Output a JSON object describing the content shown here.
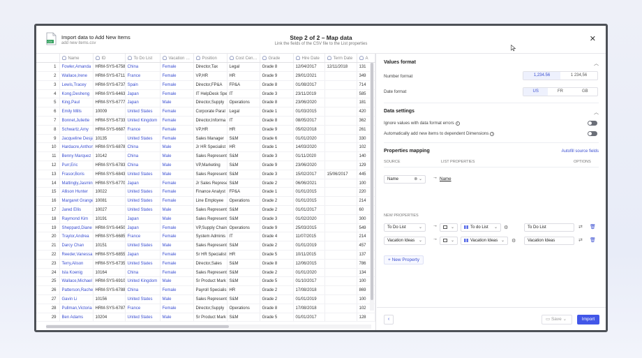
{
  "header": {
    "title": "Import data to Add New Items",
    "filename": "add new items.csv",
    "file_ext": "CSV",
    "step": "Step 2 of 2 – Map data",
    "step_sub": "Link the fields of the CSV file to the List properties"
  },
  "grid": {
    "columns": [
      "",
      "Name",
      "ID",
      "To Do List",
      "Vacation …",
      "Position",
      "Cost Cen…",
      "Grade",
      "Hire Date",
      "Term Date",
      "A"
    ],
    "rows": [
      [
        "1",
        "Fowler,Amanda",
        "HRM-SYS-6758",
        "China",
        "Female",
        "Director,Tax",
        "Legal",
        "Grade 8",
        "12/04/2017",
        "12/11/2018",
        "131"
      ],
      [
        "2",
        "Wallace,Irene",
        "HRM-SYS-6711",
        "France",
        "Female",
        "VP,HR",
        "HR",
        "Grade 9",
        "29/01/2021",
        "",
        "349"
      ],
      [
        "3",
        "Lewis,Tracey",
        "HRM-SYS-6737",
        "Spain",
        "Female",
        "Director,FP&A",
        "FP&A",
        "Grade 8",
        "01/08/2017",
        "",
        "714"
      ],
      [
        "4",
        "Kong,Desheng",
        "HRM-SYS-6463",
        "Japan",
        "Female",
        "IT HelpDesk Spe",
        "IT",
        "Grade 3",
        "23/11/2019",
        "",
        "585"
      ],
      [
        "5",
        "King,Paul",
        "HRM-SYS-6777",
        "Japan",
        "Male",
        "Director,Supply",
        "Operations",
        "Grade 8",
        "23/06/2020",
        "",
        "181"
      ],
      [
        "6",
        "Emily Mills",
        "10009",
        "United States",
        "Female",
        "Corporate Paral",
        "Legal",
        "Grade 1",
        "01/03/2015",
        "",
        "420"
      ],
      [
        "7",
        "Bonnet,Juliette",
        "HRM-SYS-6733",
        "United Kingdom",
        "Female",
        "Director,Informa",
        "IT",
        "Grade 8",
        "08/05/2017",
        "",
        "362"
      ],
      [
        "8",
        "Schwartz,Amy",
        "HRM-SYS-6687",
        "France",
        "Female",
        "VP,HR",
        "HR",
        "Grade 9",
        "05/02/2018",
        "",
        "261"
      ],
      [
        "9",
        "Jacqueline Desjar",
        "10135",
        "United States",
        "Female",
        "Sales Manager",
        "S&M",
        "Grade 6",
        "01/01/2020",
        "",
        "330"
      ],
      [
        "10",
        "Hardacre,Anthon",
        "HRM-SYS-6878",
        "China",
        "Male",
        "Jr HR Specialist",
        "HR",
        "Grade 1",
        "14/03/2020",
        "",
        "102"
      ],
      [
        "11",
        "Benny Marquez",
        "10142",
        "China",
        "Male",
        "Sales Represent",
        "S&M",
        "Grade 3",
        "01/11/2020",
        "",
        "140"
      ],
      [
        "12",
        "Purr,Eric",
        "HRM-SYS-6783",
        "China",
        "Male",
        "VP,Marketing",
        "S&M",
        "Grade 9",
        "23/06/2020",
        "",
        "129"
      ],
      [
        "13",
        "Frasor,Boris",
        "HRM-SYS-6843",
        "United States",
        "Male",
        "Sales Represent",
        "S&M",
        "Grade 3",
        "15/02/2017",
        "15/06/2017",
        "445"
      ],
      [
        "14",
        "Mattingly,Jasmin",
        "HRM-SYS-6770",
        "Japan",
        "Female",
        "Jr Sales Represe",
        "S&M",
        "Grade 2",
        "06/06/2021",
        "",
        "100"
      ],
      [
        "15",
        "Allison Hunter",
        "10022",
        "United States",
        "Female",
        "Finance Analyst",
        "FP&A",
        "Grade 1",
        "01/01/2015",
        "",
        "220"
      ],
      [
        "16",
        "Margaret Grange",
        "10081",
        "United States",
        "Female",
        "Line Employee",
        "Operations",
        "Grade 2",
        "01/01/2015",
        "",
        "214"
      ],
      [
        "17",
        "Jared Ellis",
        "10027",
        "United States",
        "Male",
        "Sales Represent",
        "S&M",
        "Grade 2",
        "01/01/2017",
        "",
        "60"
      ],
      [
        "18",
        "Raymond Kim",
        "10191",
        "Japan",
        "Male",
        "Sales Represent",
        "S&M",
        "Grade 3",
        "01/02/2020",
        "",
        "300"
      ],
      [
        "19",
        "Sheppard,Diane",
        "HRM-SYS-6450",
        "Japan",
        "Female",
        "VP,Supply Chain",
        "Operations",
        "Grade 9",
        "25/03/2015",
        "",
        "549"
      ],
      [
        "20",
        "Traylor,Andrea",
        "HRM-SYS-6685",
        "France",
        "Female",
        "System Adminis",
        "IT",
        "Grade 4",
        "11/07/2015",
        "",
        "214"
      ],
      [
        "21",
        "Darcy Chan",
        "10151",
        "United States",
        "Male",
        "Sales Represent",
        "S&M",
        "Grade 2",
        "01/01/2019",
        "",
        "457"
      ],
      [
        "22",
        "Reeder,Vanessa",
        "HRM-SYS-6855",
        "Japan",
        "Female",
        "Sr HR Specialist",
        "HR",
        "Grade 5",
        "10/11/2015",
        "",
        "137"
      ],
      [
        "23",
        "Terry,Alison",
        "HRM-SYS-6735",
        "United States",
        "Female",
        "Director,Sales",
        "S&M",
        "Grade 8",
        "12/06/2015",
        "",
        "786"
      ],
      [
        "24",
        "Isla Koenig",
        "10164",
        "China",
        "Female",
        "Sales Represent",
        "S&M",
        "Grade 2",
        "01/01/2020",
        "",
        "134"
      ],
      [
        "25",
        "Wallace,Michael",
        "HRM-SYS-6910",
        "United Kingdom",
        "Male",
        "Sr Product Mark",
        "S&M",
        "Grade 5",
        "01/10/2017",
        "",
        "100"
      ],
      [
        "26",
        "Patterson,Rachel",
        "HRM-SYS-6788",
        "China",
        "Female",
        "Payroll Specialis",
        "HR",
        "Grade 2",
        "17/08/2018",
        "",
        "869"
      ],
      [
        "27",
        "Gavin Li",
        "10156",
        "United States",
        "Male",
        "Sales Represent",
        "S&M",
        "Grade 2",
        "01/01/2019",
        "",
        "100"
      ],
      [
        "28",
        "Pullman,Victoria",
        "HRM-SYS-6787",
        "France",
        "Female",
        "Director,Supply",
        "Operations",
        "Grade 8",
        "17/08/2018",
        "",
        "102"
      ],
      [
        "29",
        "Ben Adams",
        "10204",
        "United States",
        "Male",
        "Sr Product Mark",
        "S&M",
        "Grade 5",
        "01/01/2017",
        "",
        "128"
      ]
    ]
  },
  "panel": {
    "values_format": {
      "title": "Values format",
      "number_label": "Number format",
      "number_opts": [
        "1,234.56",
        "1 234,56"
      ],
      "date_label": "Date format",
      "date_opts": [
        "US",
        "FR",
        "GB"
      ]
    },
    "data_settings": {
      "title": "Data settings",
      "opt1": "Ignore values with data format errors",
      "opt2": "Automatically add new items to dependent Dimensions"
    },
    "mapping": {
      "title": "Properties mapping",
      "autofill": "Autofill source fields",
      "col_source": "SOURCE",
      "col_list": "LIST PROPERTIES",
      "col_options": "OPTIONS",
      "name_source": "Name",
      "name_target": "Name",
      "new_props": "NEW PROPERTIES",
      "row1": {
        "source": "To Do List",
        "list": "To do List",
        "name": "To Do List"
      },
      "row2": {
        "source": "Vacation Ideas",
        "list": "Vacation Ideas",
        "name": "Vacation Ideas"
      },
      "add_property": "+ New Property"
    }
  },
  "footer": {
    "back": "‹",
    "save": "Save",
    "import": "Import"
  },
  "colors": {
    "accent": "#4257e8",
    "link": "#3b4fd1"
  }
}
